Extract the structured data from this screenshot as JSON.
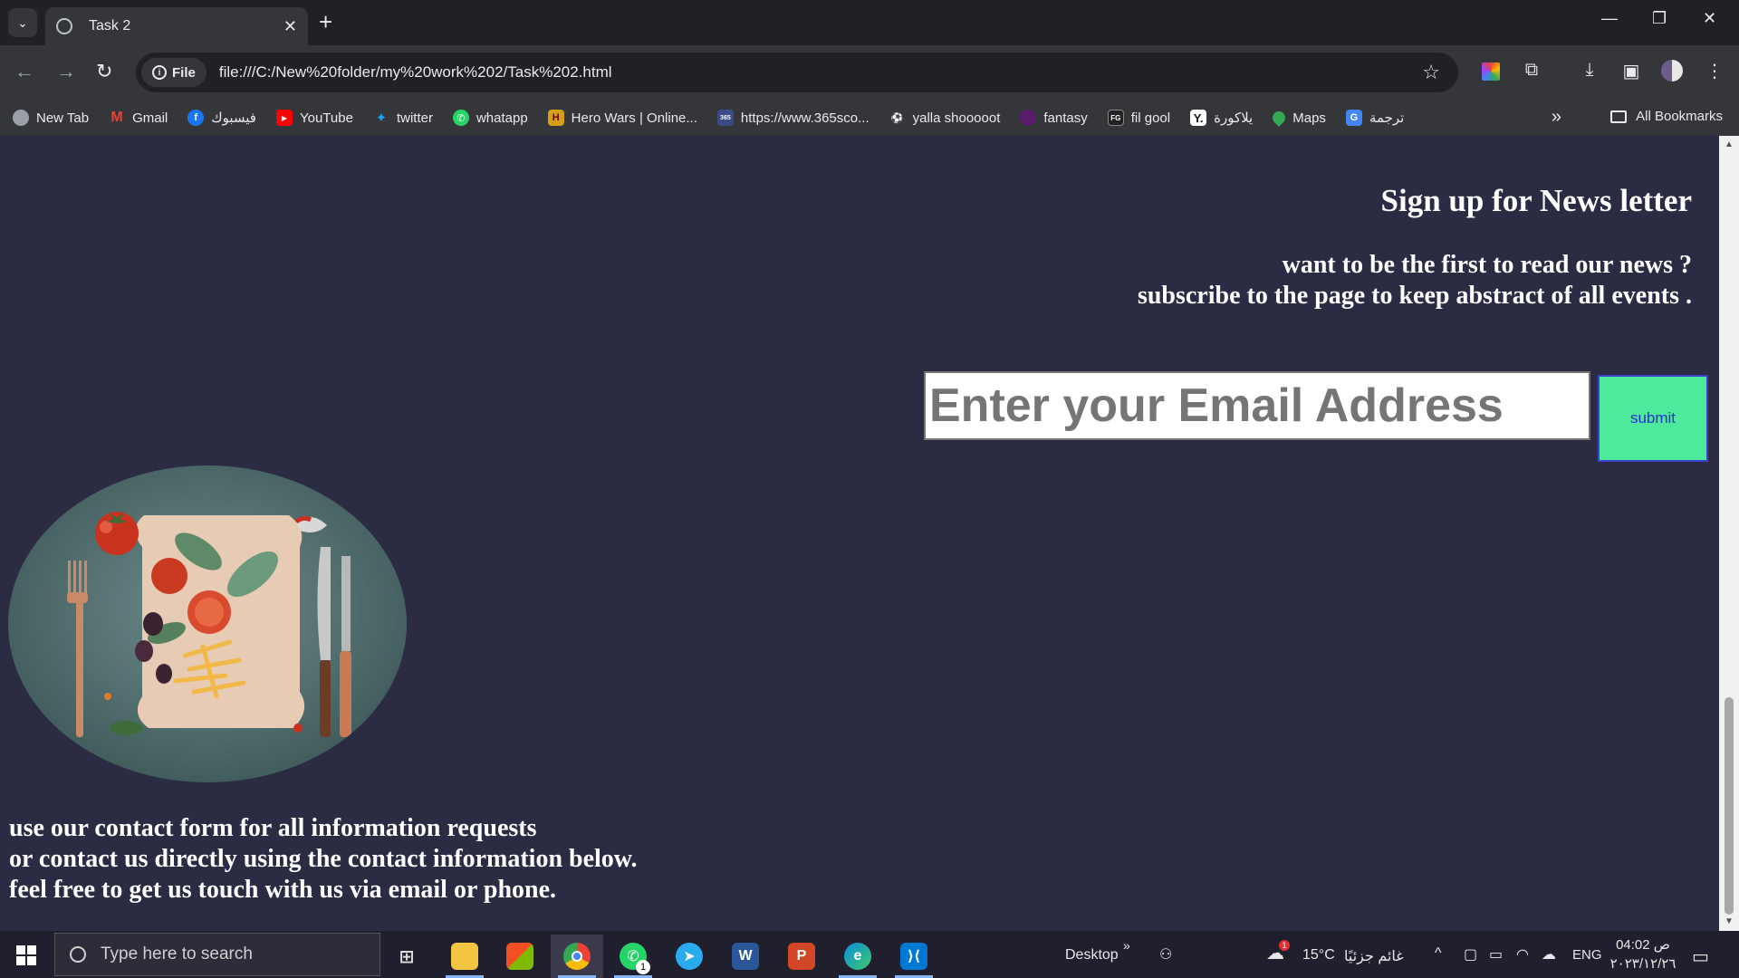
{
  "browser": {
    "tab_title": "Task 2",
    "url": "file:///C:/New%20folder/my%20work%202/Task%202.html",
    "file_chip": "File",
    "bookmarks": [
      {
        "label": "New Tab",
        "icon": "globe-icon",
        "color": "#9aa0a6"
      },
      {
        "label": "Gmail",
        "icon": "gmail-icon",
        "color": "#ea4335"
      },
      {
        "label": "فيسبوك",
        "icon": "facebook-icon",
        "color": "#1877f2"
      },
      {
        "label": "YouTube",
        "icon": "youtube-icon",
        "color": "#ff0000"
      },
      {
        "label": "twitter",
        "icon": "twitter-icon",
        "color": "#1da1f2"
      },
      {
        "label": "whatapp",
        "icon": "whatsapp-icon",
        "color": "#25d366"
      },
      {
        "label": "Hero Wars | Online...",
        "icon": "hero-wars-icon",
        "color": "#d4a017"
      },
      {
        "label": "https://www.365sco...",
        "icon": "365scores-icon",
        "color": "#3b4a8a"
      },
      {
        "label": "yalla shooooot",
        "icon": "yalla-shoot-icon",
        "color": "#444444"
      },
      {
        "label": "fantasy",
        "icon": "premier-league-icon",
        "color": "#5a1b6e"
      },
      {
        "label": "fil gool",
        "icon": "filgoal-icon",
        "color": "#222222"
      },
      {
        "label": "يلاكورة",
        "icon": "yallakora-icon",
        "color": "#111111"
      },
      {
        "label": "Maps",
        "icon": "maps-icon",
        "color": "#34a853"
      },
      {
        "label": "ترجمة",
        "icon": "translate-icon",
        "color": "#4285f4"
      }
    ],
    "all_bookmarks": "All Bookmarks"
  },
  "page": {
    "signup_title": "Sign up for News letter",
    "signup_line1": "want to be the first to read our news ?",
    "signup_line2": "subscribe to the page to keep abstract of all events .",
    "email_placeholder": "Enter your Email Address",
    "submit_label": "submit",
    "contact_line1": "use our contact form for all information requests",
    "contact_line2": "or contact us directly using the contact information below.",
    "contact_line3": "feel free to get us touch with us via email or phone."
  },
  "taskbar": {
    "search_placeholder": "Type here to search",
    "desktop_label": "Desktop",
    "weather_temp": "15°C",
    "weather_text": "غائم جزئيًا",
    "language": "ENG",
    "time": "04:02 ص",
    "date": "٢٠٢٣/١٢/٢٦",
    "whatsapp_badge": "1",
    "weather_badge": "1"
  },
  "colors": {
    "page_background": "#2b2c44",
    "submit_background": "#4eea9b"
  }
}
